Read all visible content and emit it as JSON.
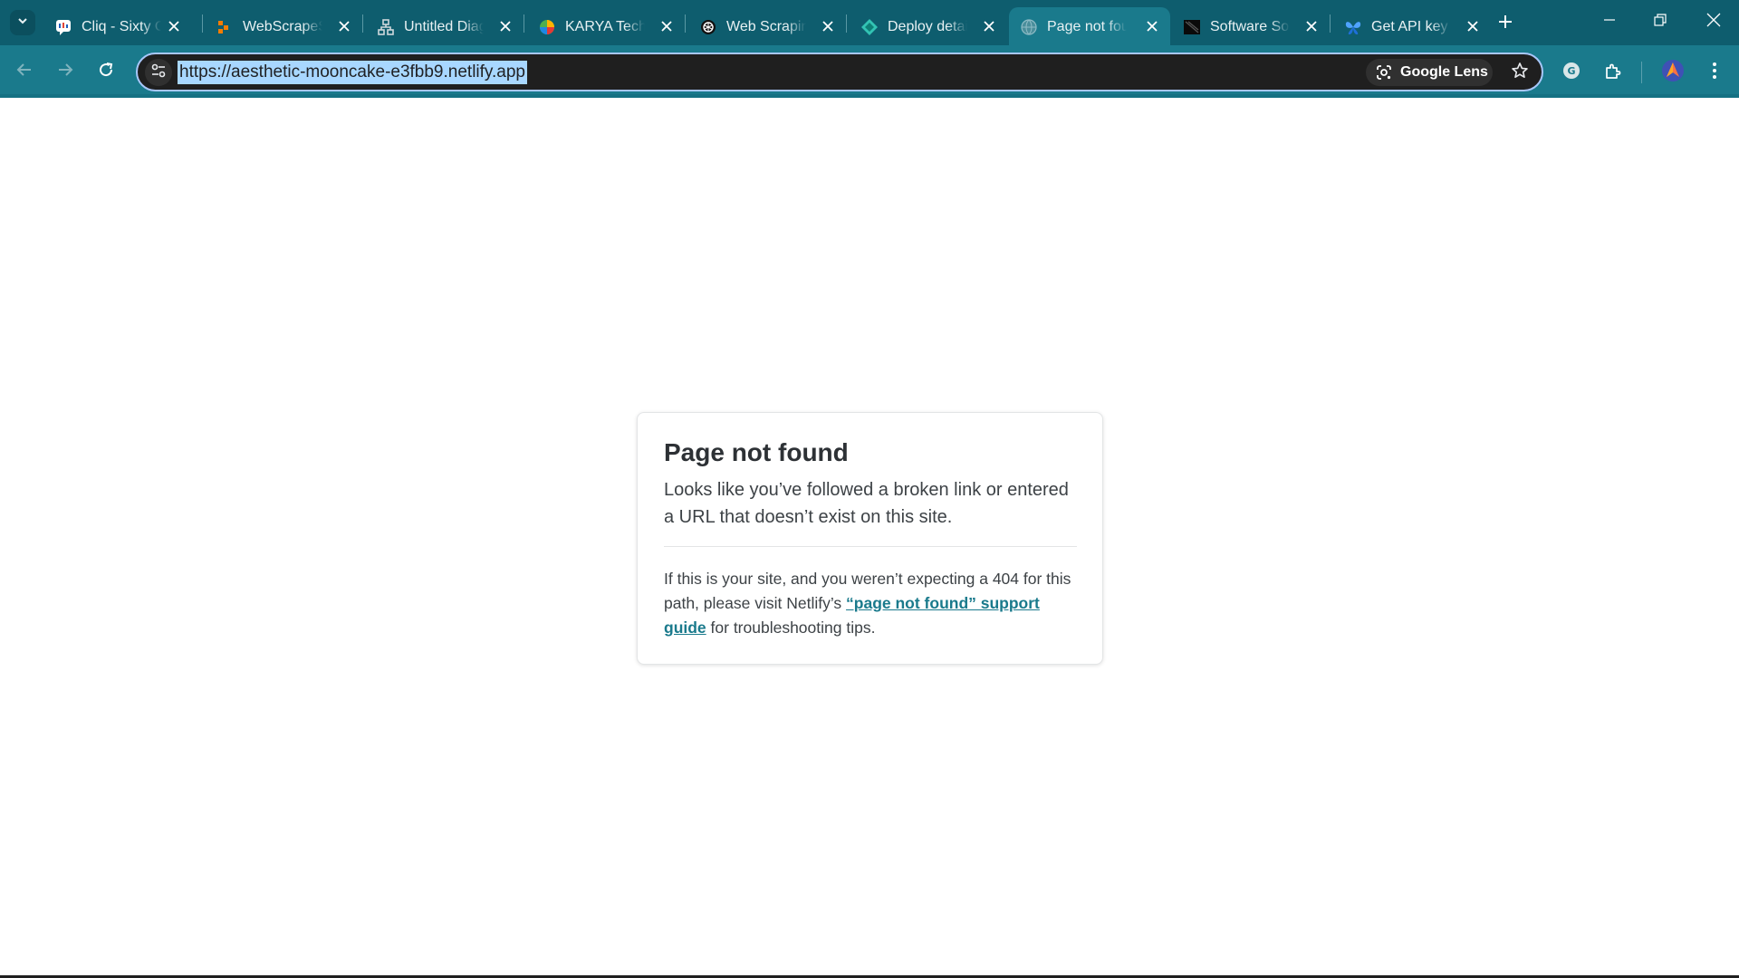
{
  "window": {
    "tab_search_icon": "chevron-down-icon",
    "controls": [
      "minimize-icon",
      "restore-icon",
      "close-icon"
    ]
  },
  "tabs": [
    {
      "title": "Cliq - Sixty One",
      "icon": "cliq-chat-icon",
      "active": false
    },
    {
      "title": "WebScrapeSuite",
      "icon": "webscrape-icon",
      "active": false
    },
    {
      "title": "Untitled Diagram",
      "icon": "diagram-icon",
      "active": false
    },
    {
      "title": "KARYA Technologies",
      "icon": "karya-icon",
      "active": false
    },
    {
      "title": "Web Scraping",
      "icon": "openai-icon",
      "active": false
    },
    {
      "title": "Deploy details",
      "icon": "netlify-icon",
      "active": false
    },
    {
      "title": "Page not found",
      "icon": "globe-icon",
      "active": true
    },
    {
      "title": "Software Solutions",
      "icon": "software-icon",
      "active": false
    },
    {
      "title": "Get API key |",
      "icon": "api-butterfly-icon",
      "active": false
    }
  ],
  "toolbar": {
    "url": "https://aesthetic-mooncake-e3fbb9.netlify.app",
    "lens_label": "Google Lens",
    "colors": {
      "frame": "#0e5d6e",
      "toolbar": "#1a7a8c",
      "selection": "#a8d7ff"
    }
  },
  "page": {
    "title": "Page not found",
    "description": "Looks like you’ve followed a broken link or entered a URL that doesn’t exist on this site.",
    "note_before": "If this is your site, and you weren’t expecting a 404 for this path, please visit Netlify’s ",
    "note_link": "“page not found” support guide",
    "note_after": " for troubleshooting tips.",
    "link_color": "#1a7a8c"
  }
}
